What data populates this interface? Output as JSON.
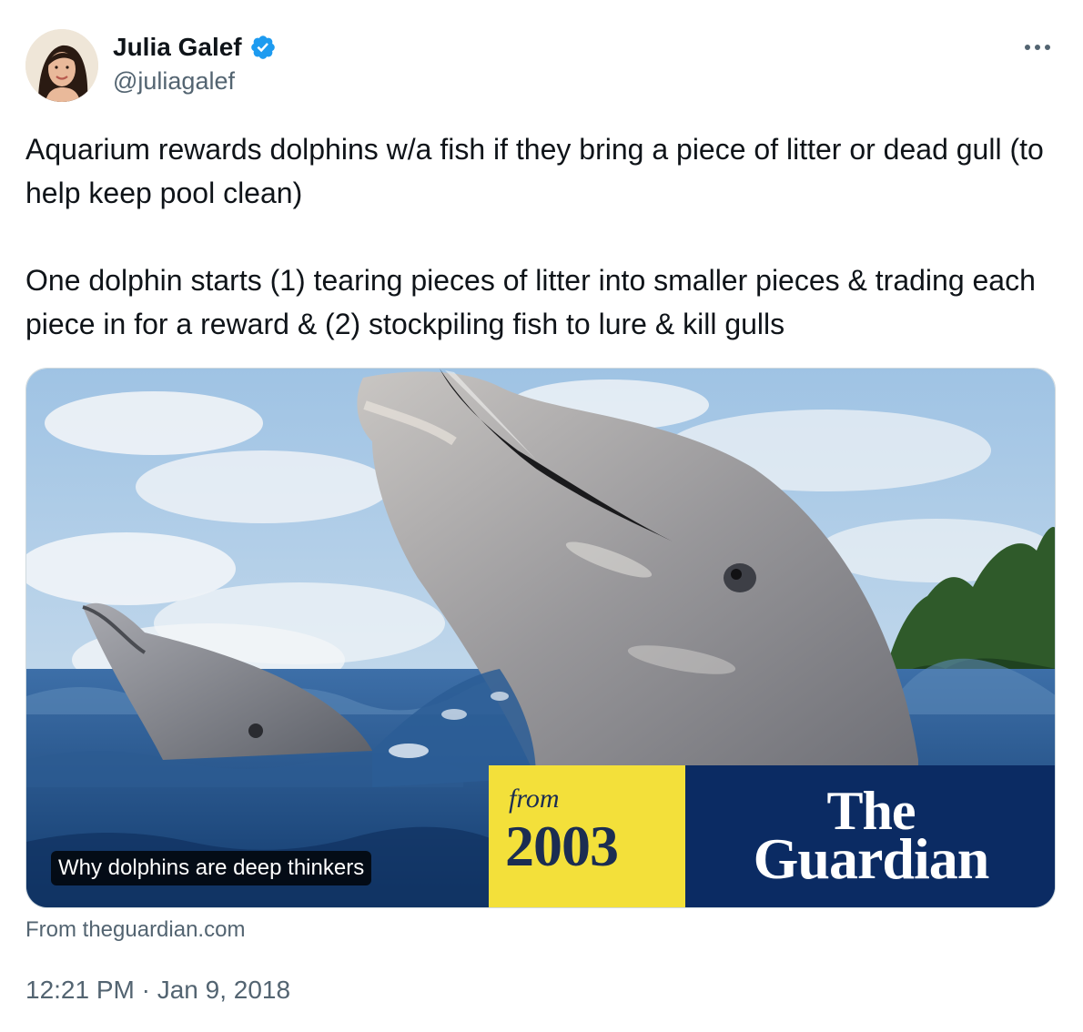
{
  "author": {
    "name": "Julia Galef",
    "handle": "@juliagalef",
    "verified": true,
    "verified_color": "#1d9bf0"
  },
  "icons": {
    "verified": "verified-badge-icon",
    "more": "more-options-icon"
  },
  "tweet": {
    "paragraphs": [
      "Aquarium rewards dolphins w/a fish if they bring a piece of litter or dead gull (to help keep pool clean)",
      "One dolphin starts (1) tearing pieces of litter into smaller pieces & trading each piece in for a reward & (2) stockpiling fish to lure & kill gulls"
    ],
    "timestamp": "12:21 PM · Jan 9, 2018"
  },
  "card": {
    "title": "Why dolphins are deep thinkers",
    "badge_from": "from",
    "badge_year": "2003",
    "brand_line1": "The",
    "brand_line2": "Guardian",
    "source": "From theguardian.com",
    "badge_yellow": "#f3e03a",
    "badge_navy": "#0b2b63"
  }
}
